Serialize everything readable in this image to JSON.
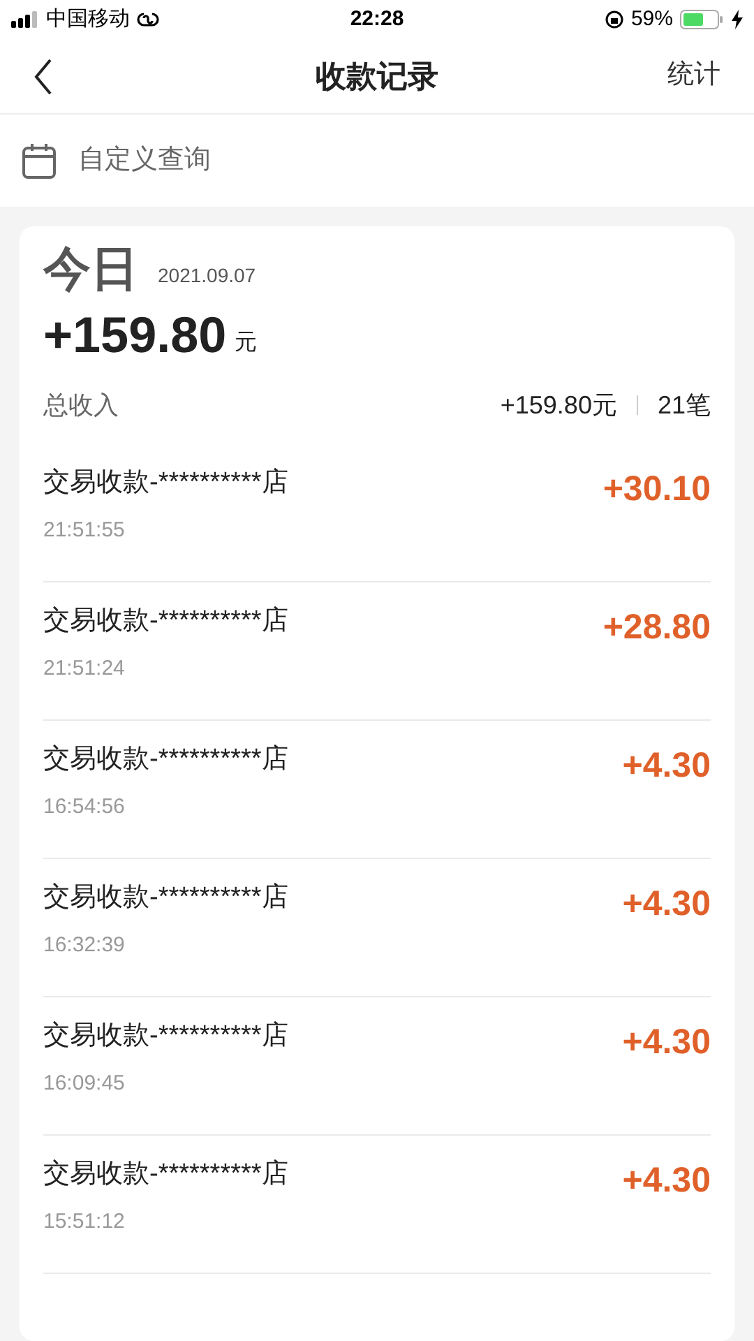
{
  "status_bar": {
    "carrier": "中国移动",
    "time": "22:28",
    "battery": "59%"
  },
  "nav": {
    "title": "收款记录",
    "action": "统计"
  },
  "query": {
    "label": "自定义查询"
  },
  "summary": {
    "day": "今日",
    "date": "2021.09.07",
    "amount": "+159.80",
    "unit": "元",
    "total_label": "总收入",
    "total": "+159.80元",
    "count": "21笔"
  },
  "transactions": [
    {
      "title": "交易收款-**********店",
      "time": "21:51:55",
      "amount": "+30.10"
    },
    {
      "title": "交易收款-**********店",
      "time": "21:51:24",
      "amount": "+28.80"
    },
    {
      "title": "交易收款-**********店",
      "time": "16:54:56",
      "amount": "+4.30"
    },
    {
      "title": "交易收款-**********店",
      "time": "16:32:39",
      "amount": "+4.30"
    },
    {
      "title": "交易收款-**********店",
      "time": "16:09:45",
      "amount": "+4.30"
    },
    {
      "title": "交易收款-**********店",
      "time": "15:51:12",
      "amount": "+4.30"
    }
  ]
}
